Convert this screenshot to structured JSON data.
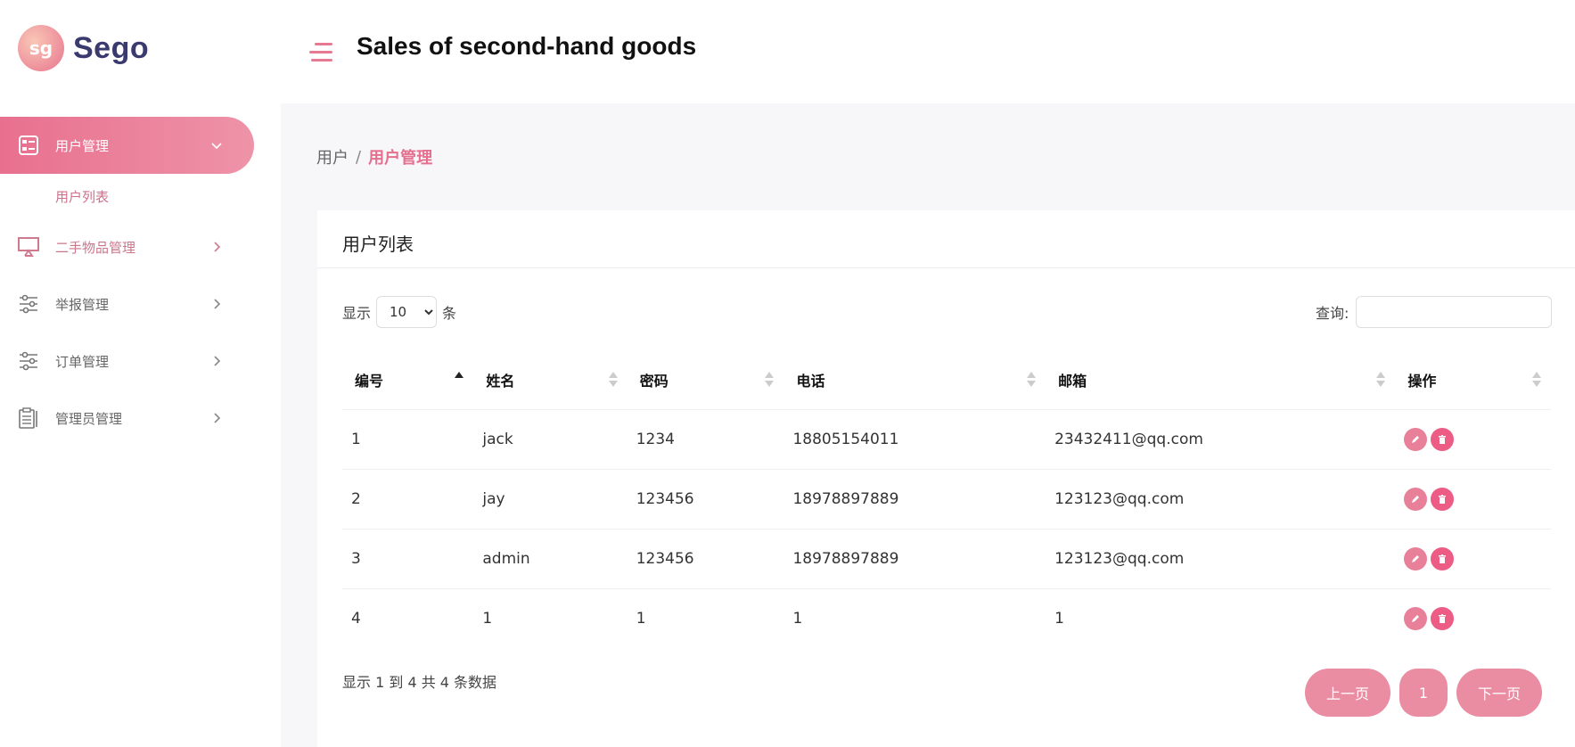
{
  "app": {
    "logo_mark": "sg",
    "logo_text": "Sego",
    "title": "Sales of second-hand goods"
  },
  "sidebar": {
    "items": [
      {
        "label": "用户管理",
        "icon": "dashboard-icon",
        "active": true
      },
      {
        "label": "二手物品管理",
        "icon": "monitor-icon"
      },
      {
        "label": "举报管理",
        "icon": "sliders-icon"
      },
      {
        "label": "订单管理",
        "icon": "sliders-icon"
      },
      {
        "label": "管理员管理",
        "icon": "clipboard-icon"
      }
    ],
    "sub_items": [
      {
        "label": "用户列表"
      }
    ]
  },
  "breadcrumb": {
    "parent": "用户",
    "separator": "/",
    "current": "用户管理"
  },
  "card": {
    "title": "用户列表",
    "length": {
      "prefix": "显示",
      "value": "10",
      "options": [
        "10"
      ],
      "suffix": "条"
    },
    "search": {
      "label": "查询:",
      "value": ""
    },
    "table": {
      "headers": [
        "编号",
        "姓名",
        "密码",
        "电话",
        "邮箱",
        "操作"
      ],
      "rows": [
        [
          "1",
          "jack",
          "1234",
          "18805154011",
          "23432411@qq.com"
        ],
        [
          "2",
          "jay",
          "123456",
          "18978897889",
          "123123@qq.com"
        ],
        [
          "3",
          "admin",
          "123456",
          "18978897889",
          "123123@qq.com"
        ],
        [
          "4",
          "1",
          "1",
          "1",
          "1"
        ]
      ]
    },
    "info": "显示 1 到 4 共 4 条数据",
    "pager": {
      "prev": "上一页",
      "current": "1",
      "next": "下一页"
    }
  },
  "colors": {
    "accent": "#e8708e",
    "delete": "#ec5c84",
    "title": "#111111",
    "brand_text": "#3a3a6e"
  }
}
